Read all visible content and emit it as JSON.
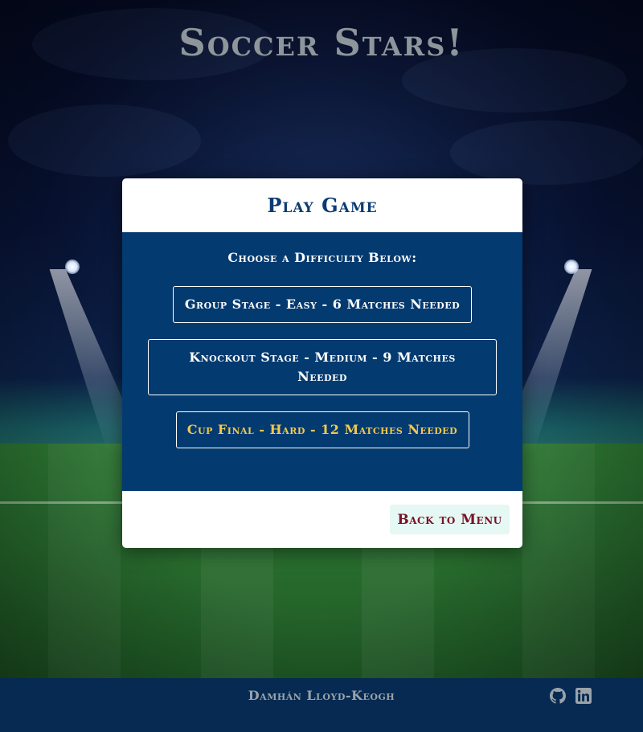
{
  "game": {
    "title": "Soccer Stars!"
  },
  "modal": {
    "title": "Play Game",
    "prompt": "Choose a Difficulty Below:",
    "options": [
      {
        "label": "Group Stage - Easy - 6 Matches Needed"
      },
      {
        "label": "Knockout Stage - Medium - 9 Matches Needed"
      },
      {
        "label": "Cup Final - Hard - 12 Matches Needed"
      }
    ],
    "back_label": "Back to Menu"
  },
  "footer": {
    "author": "Damhán Lloyd-Keogh",
    "icons": [
      "github-icon",
      "linkedin-icon"
    ]
  },
  "colors": {
    "modal_body": "#033a6f",
    "title_text": "#0b3b72",
    "hard_text": "#f2c94c",
    "back_text": "#7a1226",
    "back_bg": "#e6f8f4",
    "footer_bg": "#062a52"
  }
}
